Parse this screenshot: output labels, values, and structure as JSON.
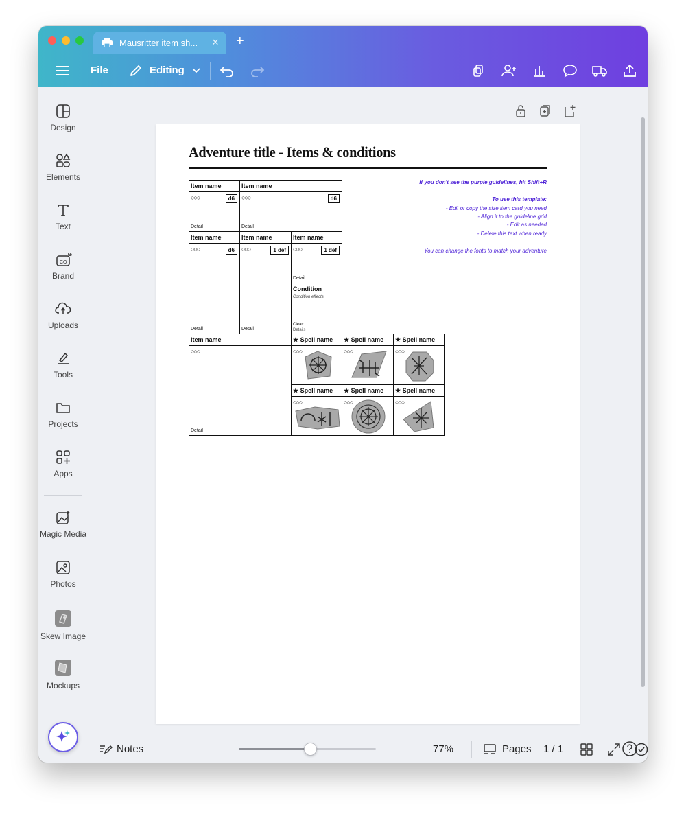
{
  "window": {
    "tab_title": "Mausritter item sh...",
    "tab_close": "✕",
    "tab_add": "+"
  },
  "toolbar": {
    "file_label": "File",
    "editing_label": "Editing"
  },
  "sidebar": {
    "items": [
      {
        "label": "Design",
        "icon": "design-icon"
      },
      {
        "label": "Elements",
        "icon": "elements-icon"
      },
      {
        "label": "Text",
        "icon": "text-icon"
      },
      {
        "label": "Brand",
        "icon": "brand-icon"
      },
      {
        "label": "Uploads",
        "icon": "uploads-icon"
      },
      {
        "label": "Tools",
        "icon": "tools-icon"
      },
      {
        "label": "Projects",
        "icon": "projects-icon"
      },
      {
        "label": "Apps",
        "icon": "apps-icon"
      },
      {
        "label": "Magic Media",
        "icon": "magic-media-icon"
      },
      {
        "label": "Photos",
        "icon": "photos-icon"
      },
      {
        "label": "Skew Image",
        "icon": "skew-image-icon"
      },
      {
        "label": "Mockups",
        "icon": "mockups-icon"
      }
    ]
  },
  "document": {
    "title": "Adventure title - Items & conditions",
    "cards": {
      "item_name": "Item name",
      "spell_name": "★ Spell name",
      "circles": "○○○",
      "detail": "Detail",
      "d6": "d6",
      "def": "1 def",
      "condition_title": "Condition",
      "condition_effects": "Condition effects",
      "condition_clear": "Clear:",
      "condition_details": "Details"
    },
    "instructions": {
      "line1": "If you don't see the purple guidelines, hit Shift+R",
      "line2": "To use this template:",
      "line3": "- Edit or copy the size item card you need",
      "line4": "- Align it to the guideline grid",
      "line5": "- Edit as needed",
      "line6": "- Delete this text when ready",
      "line7": "You can change the fonts to match your adventure"
    }
  },
  "bottombar": {
    "notes_label": "Notes",
    "zoom_label": "77%",
    "zoom_value": 0.52,
    "pages_label": "Pages",
    "page_count": "1 / 1"
  },
  "colors": {
    "accent_purple": "#6f3fe0",
    "accent_teal": "#3fb6c9",
    "instruction_text": "#4b1fd6"
  }
}
